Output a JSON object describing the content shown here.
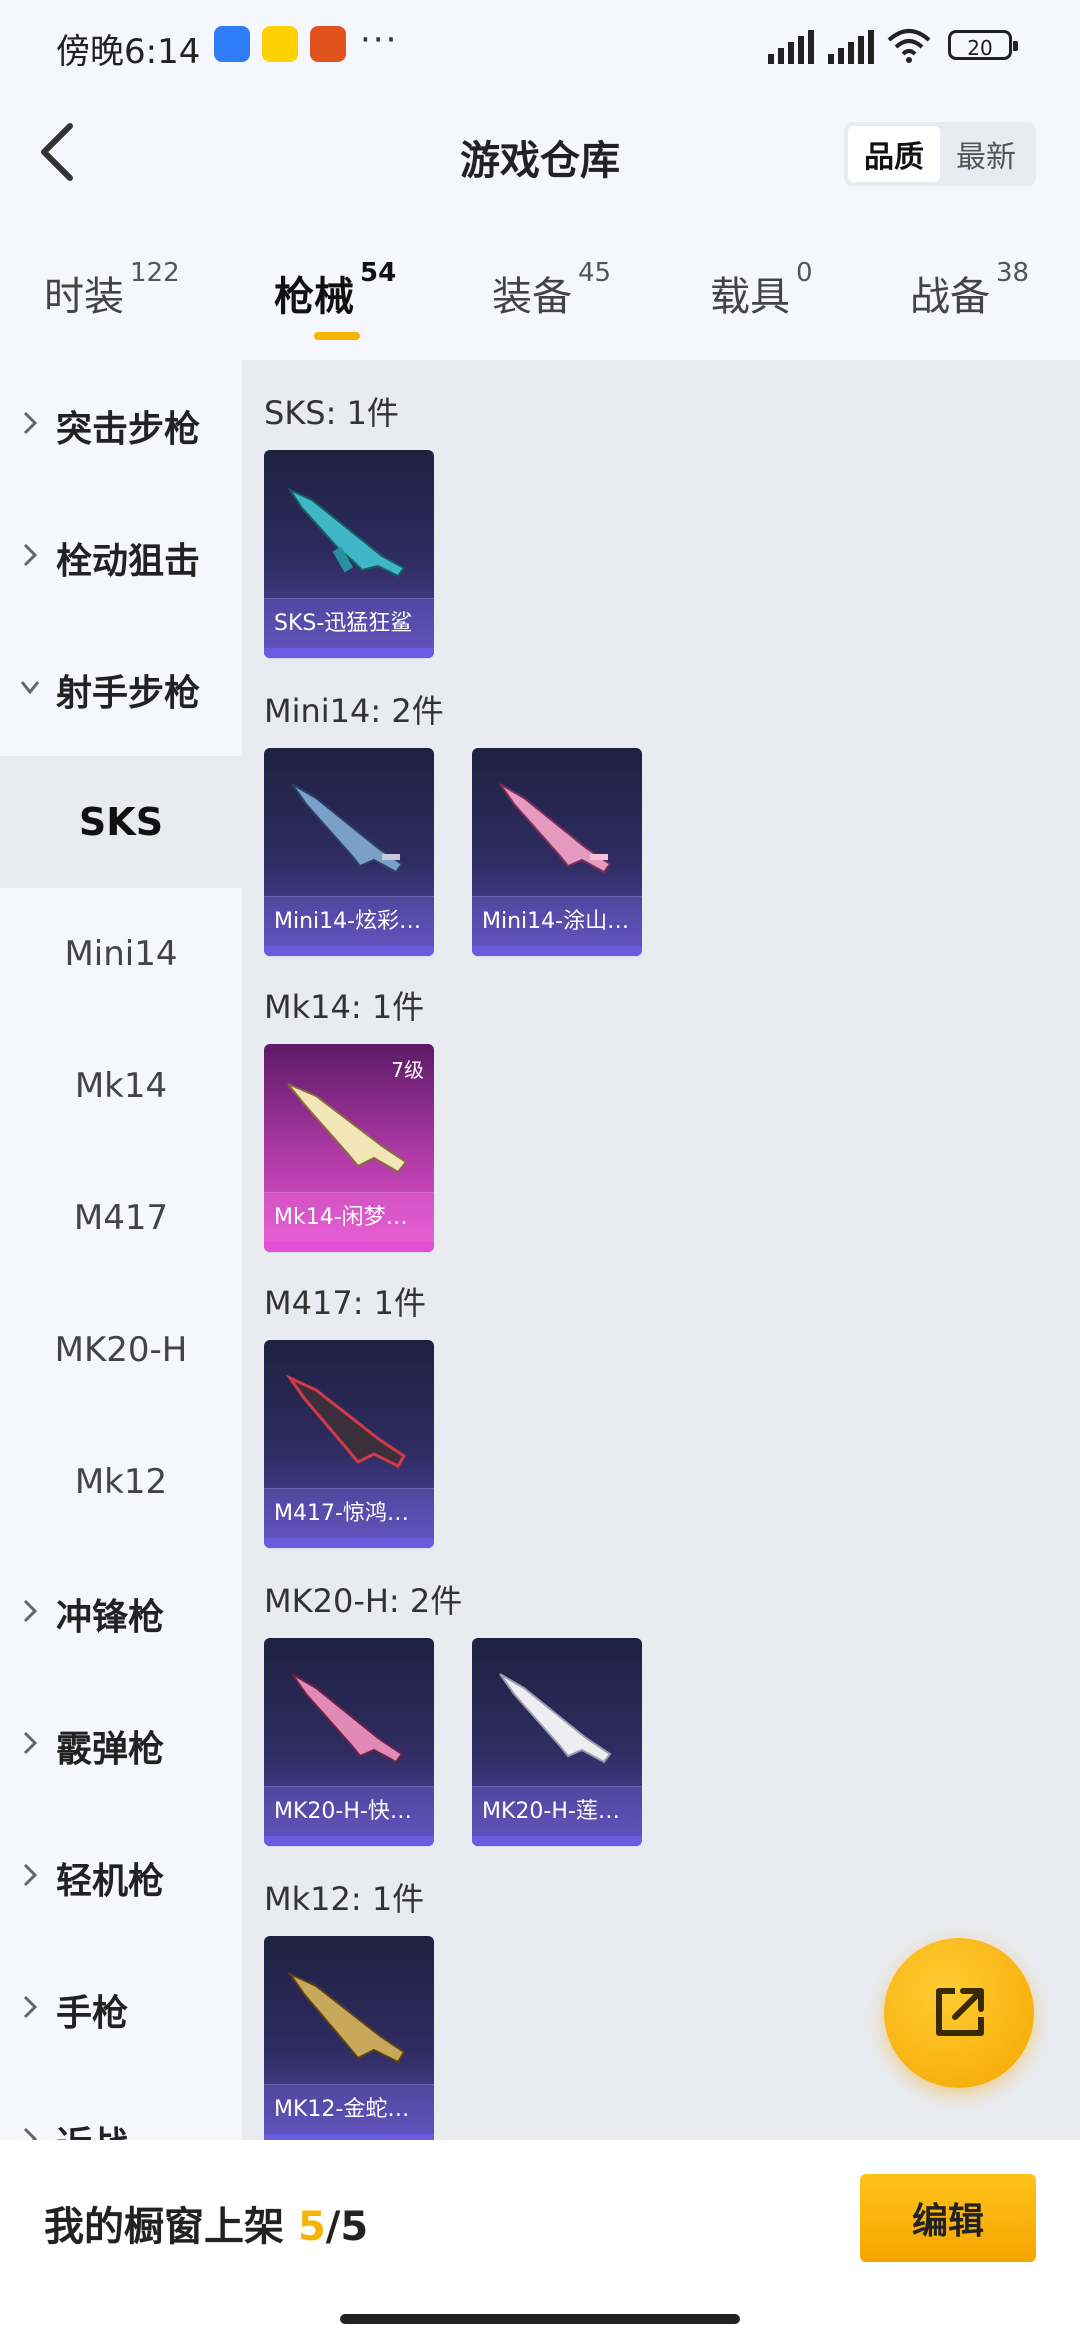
{
  "status_bar": {
    "time": "傍晚6:14",
    "more": "···",
    "battery": "20"
  },
  "header": {
    "title": "游戏仓库",
    "sort": [
      "品质",
      "最新"
    ]
  },
  "tabs": [
    {
      "label": "时装",
      "count": "122"
    },
    {
      "label": "枪械",
      "count": "54"
    },
    {
      "label": "装备",
      "count": "45"
    },
    {
      "label": "载具",
      "count": "0"
    },
    {
      "label": "战备",
      "count": "38"
    }
  ],
  "sidebar": {
    "items": [
      {
        "label": "突击步枪"
      },
      {
        "label": "栓动狙击"
      },
      {
        "label": "射手步枪"
      },
      {
        "label": "SKS"
      },
      {
        "label": "Mini14"
      },
      {
        "label": "Mk14"
      },
      {
        "label": "M417"
      },
      {
        "label": "MK20-H"
      },
      {
        "label": "Mk12"
      },
      {
        "label": "冲锋枪"
      },
      {
        "label": "霰弹枪"
      },
      {
        "label": "轻机枪"
      },
      {
        "label": "手枪"
      },
      {
        "label": "近战"
      }
    ]
  },
  "groups": [
    {
      "title": "SKS: 1件",
      "items": [
        {
          "name": "SKS-迅猛狂鲨"
        }
      ]
    },
    {
      "title": "Mini14: 2件",
      "items": [
        {
          "name": "Mini14-炫彩…"
        },
        {
          "name": "Mini14-涂山…"
        }
      ]
    },
    {
      "title": "Mk14: 1件",
      "items": [
        {
          "name": "Mk14-闲梦…",
          "level": "7级"
        }
      ]
    },
    {
      "title": "M417: 1件",
      "items": [
        {
          "name": "M417-惊鸿…"
        }
      ]
    },
    {
      "title": "MK20-H: 2件",
      "items": [
        {
          "name": "MK20-H-快…"
        },
        {
          "name": "MK20-H-莲…"
        }
      ]
    },
    {
      "title": "Mk12: 1件",
      "items": [
        {
          "name": "MK12-金蛇…"
        }
      ]
    }
  ],
  "bottom": {
    "caption": "我的橱窗上架",
    "current": "5",
    "total": "/5",
    "edit_label": "编辑"
  },
  "colors": {
    "accent": "#f6b400",
    "card_purple": "#2f2c62",
    "card_pink": "#b23aa8"
  }
}
